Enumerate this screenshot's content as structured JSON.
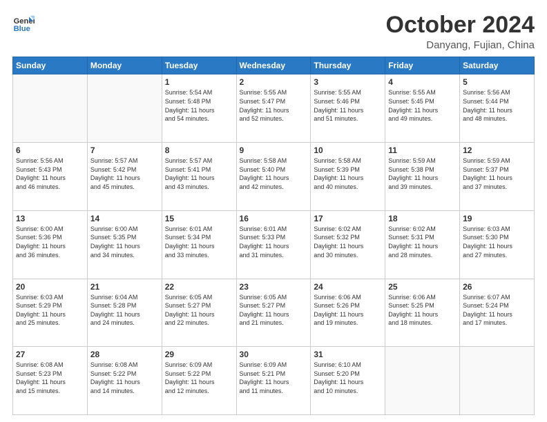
{
  "header": {
    "logo_line1": "General",
    "logo_line2": "Blue",
    "month": "October 2024",
    "location": "Danyang, Fujian, China"
  },
  "weekdays": [
    "Sunday",
    "Monday",
    "Tuesday",
    "Wednesday",
    "Thursday",
    "Friday",
    "Saturday"
  ],
  "weeks": [
    [
      {
        "day": "",
        "info": ""
      },
      {
        "day": "",
        "info": ""
      },
      {
        "day": "1",
        "info": "Sunrise: 5:54 AM\nSunset: 5:48 PM\nDaylight: 11 hours\nand 54 minutes."
      },
      {
        "day": "2",
        "info": "Sunrise: 5:55 AM\nSunset: 5:47 PM\nDaylight: 11 hours\nand 52 minutes."
      },
      {
        "day": "3",
        "info": "Sunrise: 5:55 AM\nSunset: 5:46 PM\nDaylight: 11 hours\nand 51 minutes."
      },
      {
        "day": "4",
        "info": "Sunrise: 5:55 AM\nSunset: 5:45 PM\nDaylight: 11 hours\nand 49 minutes."
      },
      {
        "day": "5",
        "info": "Sunrise: 5:56 AM\nSunset: 5:44 PM\nDaylight: 11 hours\nand 48 minutes."
      }
    ],
    [
      {
        "day": "6",
        "info": "Sunrise: 5:56 AM\nSunset: 5:43 PM\nDaylight: 11 hours\nand 46 minutes."
      },
      {
        "day": "7",
        "info": "Sunrise: 5:57 AM\nSunset: 5:42 PM\nDaylight: 11 hours\nand 45 minutes."
      },
      {
        "day": "8",
        "info": "Sunrise: 5:57 AM\nSunset: 5:41 PM\nDaylight: 11 hours\nand 43 minutes."
      },
      {
        "day": "9",
        "info": "Sunrise: 5:58 AM\nSunset: 5:40 PM\nDaylight: 11 hours\nand 42 minutes."
      },
      {
        "day": "10",
        "info": "Sunrise: 5:58 AM\nSunset: 5:39 PM\nDaylight: 11 hours\nand 40 minutes."
      },
      {
        "day": "11",
        "info": "Sunrise: 5:59 AM\nSunset: 5:38 PM\nDaylight: 11 hours\nand 39 minutes."
      },
      {
        "day": "12",
        "info": "Sunrise: 5:59 AM\nSunset: 5:37 PM\nDaylight: 11 hours\nand 37 minutes."
      }
    ],
    [
      {
        "day": "13",
        "info": "Sunrise: 6:00 AM\nSunset: 5:36 PM\nDaylight: 11 hours\nand 36 minutes."
      },
      {
        "day": "14",
        "info": "Sunrise: 6:00 AM\nSunset: 5:35 PM\nDaylight: 11 hours\nand 34 minutes."
      },
      {
        "day": "15",
        "info": "Sunrise: 6:01 AM\nSunset: 5:34 PM\nDaylight: 11 hours\nand 33 minutes."
      },
      {
        "day": "16",
        "info": "Sunrise: 6:01 AM\nSunset: 5:33 PM\nDaylight: 11 hours\nand 31 minutes."
      },
      {
        "day": "17",
        "info": "Sunrise: 6:02 AM\nSunset: 5:32 PM\nDaylight: 11 hours\nand 30 minutes."
      },
      {
        "day": "18",
        "info": "Sunrise: 6:02 AM\nSunset: 5:31 PM\nDaylight: 11 hours\nand 28 minutes."
      },
      {
        "day": "19",
        "info": "Sunrise: 6:03 AM\nSunset: 5:30 PM\nDaylight: 11 hours\nand 27 minutes."
      }
    ],
    [
      {
        "day": "20",
        "info": "Sunrise: 6:03 AM\nSunset: 5:29 PM\nDaylight: 11 hours\nand 25 minutes."
      },
      {
        "day": "21",
        "info": "Sunrise: 6:04 AM\nSunset: 5:28 PM\nDaylight: 11 hours\nand 24 minutes."
      },
      {
        "day": "22",
        "info": "Sunrise: 6:05 AM\nSunset: 5:27 PM\nDaylight: 11 hours\nand 22 minutes."
      },
      {
        "day": "23",
        "info": "Sunrise: 6:05 AM\nSunset: 5:27 PM\nDaylight: 11 hours\nand 21 minutes."
      },
      {
        "day": "24",
        "info": "Sunrise: 6:06 AM\nSunset: 5:26 PM\nDaylight: 11 hours\nand 19 minutes."
      },
      {
        "day": "25",
        "info": "Sunrise: 6:06 AM\nSunset: 5:25 PM\nDaylight: 11 hours\nand 18 minutes."
      },
      {
        "day": "26",
        "info": "Sunrise: 6:07 AM\nSunset: 5:24 PM\nDaylight: 11 hours\nand 17 minutes."
      }
    ],
    [
      {
        "day": "27",
        "info": "Sunrise: 6:08 AM\nSunset: 5:23 PM\nDaylight: 11 hours\nand 15 minutes."
      },
      {
        "day": "28",
        "info": "Sunrise: 6:08 AM\nSunset: 5:22 PM\nDaylight: 11 hours\nand 14 minutes."
      },
      {
        "day": "29",
        "info": "Sunrise: 6:09 AM\nSunset: 5:22 PM\nDaylight: 11 hours\nand 12 minutes."
      },
      {
        "day": "30",
        "info": "Sunrise: 6:09 AM\nSunset: 5:21 PM\nDaylight: 11 hours\nand 11 minutes."
      },
      {
        "day": "31",
        "info": "Sunrise: 6:10 AM\nSunset: 5:20 PM\nDaylight: 11 hours\nand 10 minutes."
      },
      {
        "day": "",
        "info": ""
      },
      {
        "day": "",
        "info": ""
      }
    ]
  ]
}
